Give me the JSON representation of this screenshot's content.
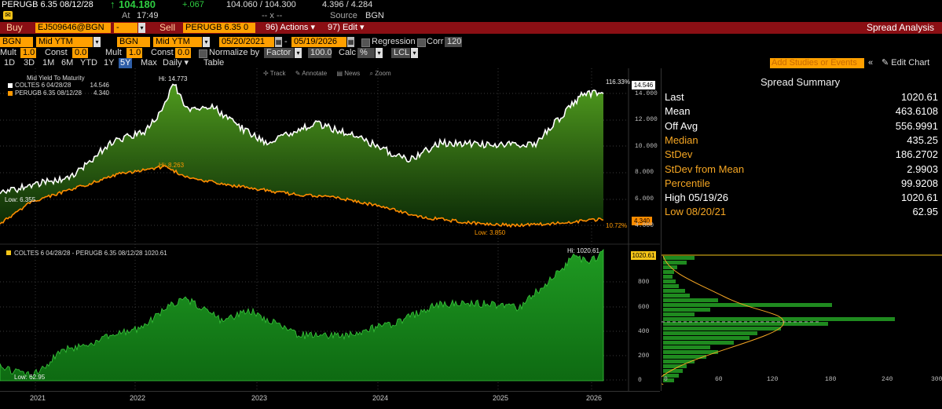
{
  "header": {
    "ticker": "PERUGB 6.35 08/12/28",
    "arrow": "↑",
    "price": "104.180",
    "change": "+.067",
    "bid_ask": "104.060 / 104.300",
    "yields": "4.396 / 4.284",
    "at_label": "At",
    "time": "17:49",
    "dash": "-- x --",
    "source_label": "Source",
    "source": "BGN"
  },
  "action_bar": {
    "buy_label": "Buy",
    "buy_security": "EJ509646@BGN",
    "dash_field": "-",
    "sell_label": "Sell",
    "sell_security": "PERUGB 6.35 0",
    "actions_num": "96)",
    "actions_label": "Actions",
    "edit_num": "97)",
    "edit_label": "Edit",
    "title": "Spread Analysis"
  },
  "settings": {
    "src1": "BGN",
    "field1": "Mid YTM",
    "src2": "BGN",
    "field2": "Mid YTM",
    "date_start": "05/20/2021",
    "date_sep": "-",
    "date_end": "05/19/2026",
    "regression_label": "Regression",
    "corr_label": "Corr",
    "corr_value": "120",
    "mult1_label": "Mult",
    "mult1": "1.0",
    "const1_label": "Const",
    "const1": "0.0",
    "mult2_label": "Mult",
    "mult2": "1.0",
    "const2_label": "Const",
    "const2": "0.0",
    "normalize_label": "Normalize by",
    "normalize_value": "Factor",
    "normalize_num": "100.0",
    "calc_label": "Calc",
    "calc_value": "%",
    "lcl": "LCL"
  },
  "periods": [
    "1D",
    "3D",
    "1M",
    "6M",
    "YTD",
    "1Y",
    "5Y",
    "Max"
  ],
  "active_period": "5Y",
  "daily_label": "Daily",
  "table_label": "Table",
  "add_studies": "Add Studies or Events",
  "edit_chart": "Edit Chart",
  "toolbar": {
    "track": "Track",
    "annotate": "Annotate",
    "news": "News",
    "zoom": "Zoom"
  },
  "top_chart": {
    "title": "Mid Yield To Maturity",
    "legend": [
      {
        "name": "COLTES 6 04/28/28",
        "value": "14.546",
        "color": "#ffffff"
      },
      {
        "name": "PERUGB 6.35 08/12/28",
        "value": "4.340",
        "color": "#ff9900"
      }
    ],
    "hi_white": "Hi: 14.773",
    "hi_orange": "Hi: 8.263",
    "low_white": "Low: 6.355",
    "low_orange": "Low: 3.850",
    "pct_white": "116.33%",
    "pct_orange": "10.72%",
    "last_white": "14.546",
    "last_orange": "4.340",
    "y_ticks": [
      "14.000",
      "12.000",
      "10.000",
      "8.000",
      "6.000",
      "4.000"
    ]
  },
  "bottom_chart": {
    "legend": "COLTES 6 04/28/28 - PERUGB 6.35 08/12/28 1020.61",
    "hi": "Hi: 1020.61",
    "low": "Low: 62.95",
    "last": "1020.61",
    "y_ticks": [
      "800",
      "600",
      "400",
      "200",
      "0"
    ],
    "hist_ticks": [
      "0",
      "60",
      "120",
      "180",
      "240",
      "300"
    ]
  },
  "x_labels": [
    "2021",
    "2022",
    "2023",
    "2024",
    "2025",
    "2026"
  ],
  "summary": {
    "title": "Spread Summary",
    "rows": [
      {
        "label": "Last",
        "value": "1020.61",
        "color": "#ffffff"
      },
      {
        "label": "Mean",
        "value": "463.6108",
        "color": "#ffffff"
      },
      {
        "label": "Off Avg",
        "value": "556.9991",
        "color": "#ffffff"
      },
      {
        "label": "Median",
        "value": "435.25",
        "color": "#f5a623"
      },
      {
        "label": "StDev",
        "value": "186.2702",
        "color": "#f5a623"
      },
      {
        "label": "StDev from Mean",
        "value": "2.9903",
        "color": "#f5a623"
      },
      {
        "label": "Percentile",
        "value": "99.9208",
        "color": "#f5a623"
      },
      {
        "label": "High 05/19/26",
        "value": "1020.61",
        "color": "#ffffff"
      },
      {
        "label": "Low 08/20/21",
        "value": "62.95",
        "color": "#f5a623"
      }
    ]
  },
  "colors": {
    "accent_orange": "#ffa000",
    "title_bar_red": "#8b0f14",
    "area_green": "#1f8a1f",
    "line_orange": "#ff8c00"
  }
}
